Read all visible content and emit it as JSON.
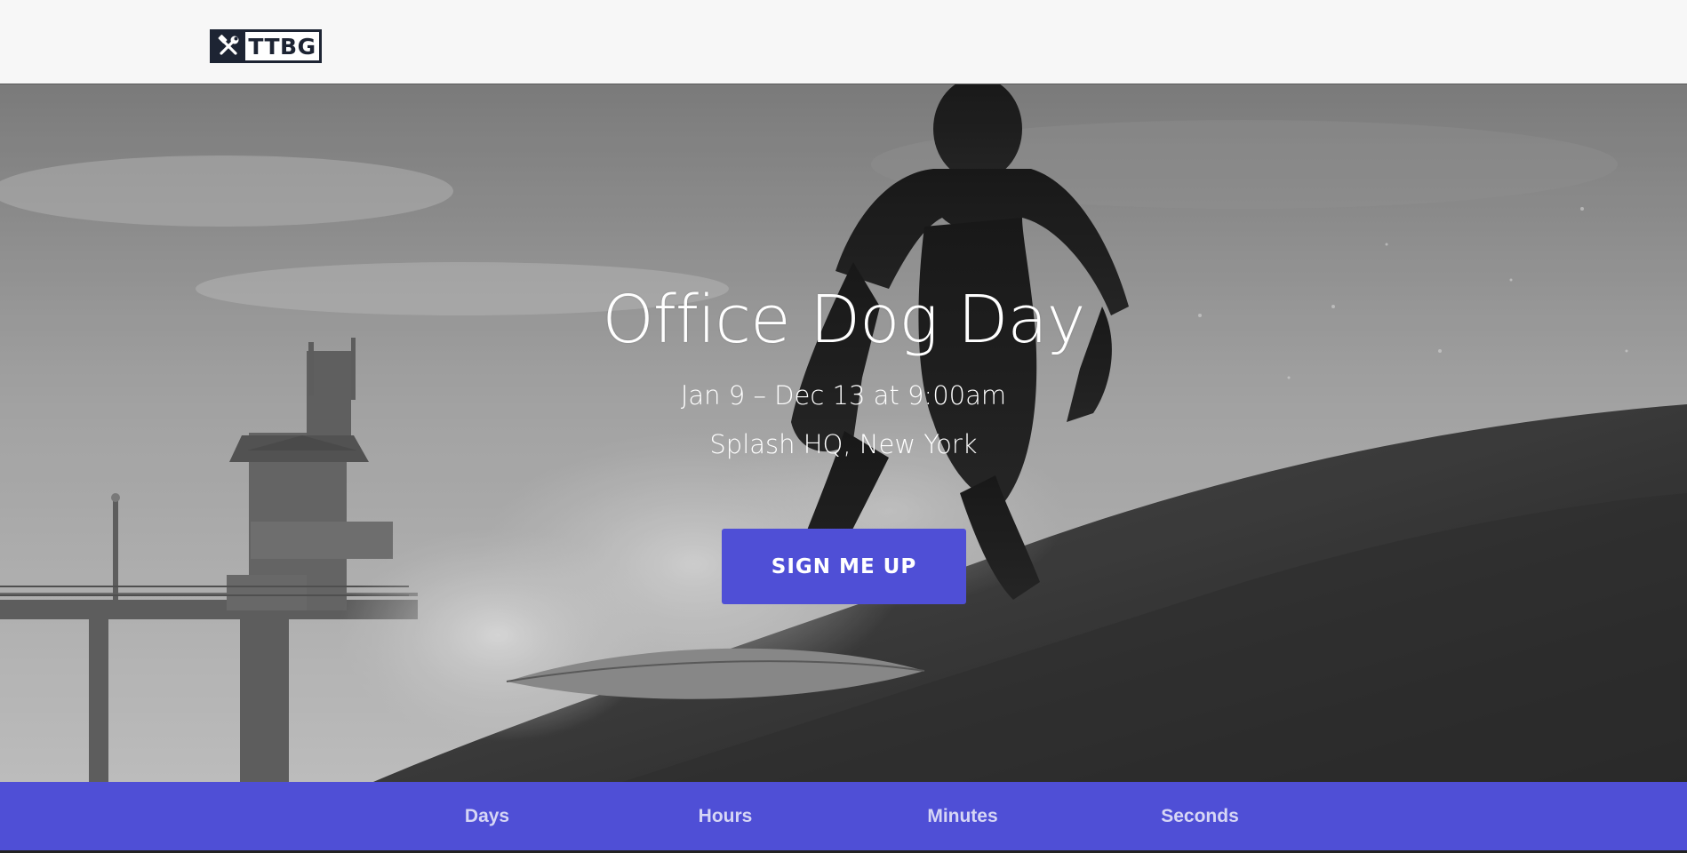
{
  "header": {
    "logo_text": "TTBG",
    "logo_icon": "hammer-wrench-icon"
  },
  "hero": {
    "title": "Office Dog Day",
    "dates": "Jan 9 – Dec 13 at 9:00am",
    "location": "Splash HQ, New York",
    "cta_label": "SIGN ME UP",
    "background": "black-and-white photo of surfer riding a wave beside a pier tower"
  },
  "countdown": {
    "labels": [
      "Days",
      "Hours",
      "Minutes",
      "Seconds"
    ]
  },
  "colors": {
    "accent": "#4f4fd6",
    "header_bg": "#f7f7f7",
    "logo_dark": "#1d2433"
  }
}
